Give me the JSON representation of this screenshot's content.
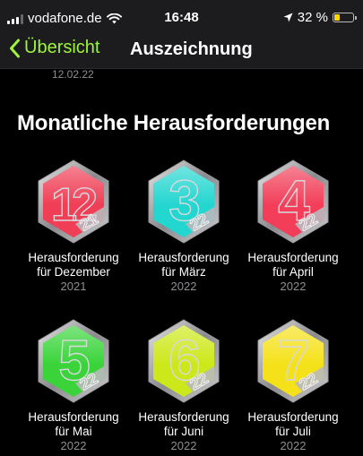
{
  "status": {
    "carrier": "vodafone.de",
    "time": "16:48",
    "battery": "32 %",
    "battery_level": 0.32
  },
  "nav": {
    "back_label": "Übersicht",
    "title": "Auszeichnung"
  },
  "prev_item": {
    "date": "12.02.22"
  },
  "section": {
    "title": "Monatliche Herausforderungen"
  },
  "awards": [
    {
      "line1": "Herausforderung",
      "line2": "für Dezember",
      "year": "2021",
      "number": "12",
      "year_short": "21",
      "color": "#ef3e55"
    },
    {
      "line1": "Herausforderung",
      "line2": "für März",
      "year": "2022",
      "number": "3",
      "year_short": "22",
      "color": "#24d6d0"
    },
    {
      "line1": "Herausforderung",
      "line2": "für April",
      "year": "2022",
      "number": "4",
      "year_short": "22",
      "color": "#f23e59"
    },
    {
      "line1": "Herausforderung",
      "line2": "für Mai",
      "year": "2022",
      "number": "5",
      "year_short": "22",
      "color": "#3ad43a"
    },
    {
      "line1": "Herausforderung",
      "line2": "für Juni",
      "year": "2022",
      "number": "6",
      "year_short": "22",
      "color": "#cde81a"
    },
    {
      "line1": "Herausforderung",
      "line2": "für Juli",
      "year": "2022",
      "number": "7",
      "year_short": "22",
      "color": "#f5e11a"
    }
  ]
}
